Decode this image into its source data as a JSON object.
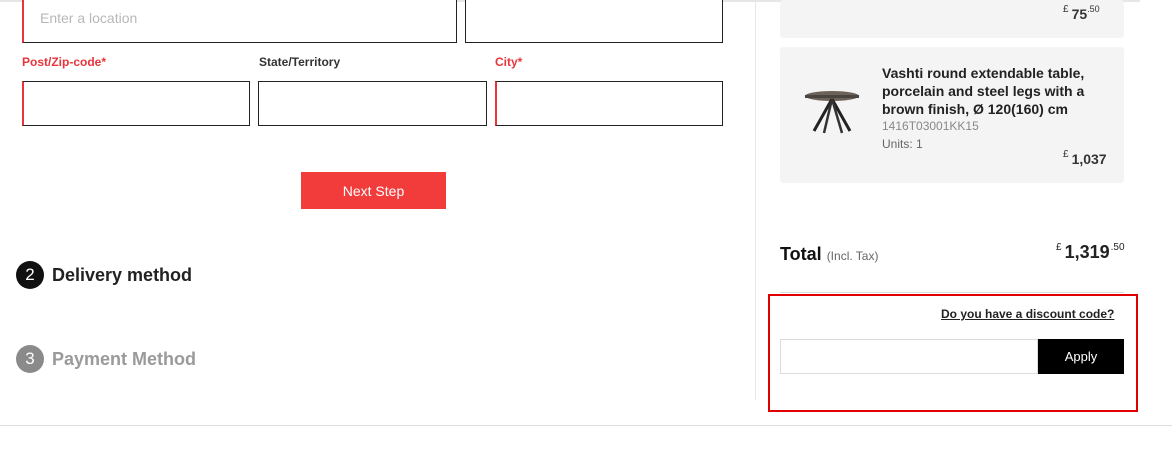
{
  "form": {
    "location_placeholder": "Enter a location",
    "labels": {
      "postcode": "Post/Zip-code*",
      "state": "State/Territory",
      "city": "City*"
    },
    "next_step": "Next Step"
  },
  "steps": [
    {
      "number": "2",
      "title": "Delivery method",
      "state": "active"
    },
    {
      "number": "3",
      "title": "Payment Method",
      "state": "inactive"
    }
  ],
  "cart": {
    "prev_item_price": {
      "currency": "£",
      "main": "75",
      "decimals": ".50"
    },
    "item": {
      "name": "Vashti round extendable table, porcelain and steel legs with a brown finish, Ø 120(160) cm",
      "sku": "1416T03001KK15",
      "units": "Units: 1",
      "price": {
        "currency": "£",
        "main": "1,037"
      }
    },
    "total": {
      "label": "Total",
      "incl": "(Incl. Tax)",
      "currency": "£",
      "main": "1,319",
      "decimals": ".50"
    }
  },
  "discount": {
    "link": "Do you have a discount code?",
    "input_value": "",
    "apply": "Apply"
  },
  "colors": {
    "accent_red": "#f23b3b",
    "required_red": "#e8343a",
    "highlight_red": "#e00000",
    "button_black": "#000000"
  }
}
